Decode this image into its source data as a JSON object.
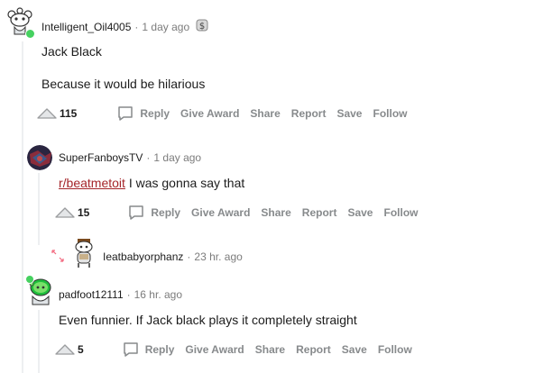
{
  "comments": [
    {
      "username": "Intelligent_Oil4005",
      "time": "1 day ago",
      "award_icon": "silver-award-icon",
      "lines": [
        "Jack Black",
        "Because it would be hilarious"
      ],
      "votes": "115",
      "actions": [
        "Reply",
        "Give Award",
        "Share",
        "Report",
        "Save",
        "Follow"
      ]
    },
    {
      "username": "SuperFanboysTV",
      "time": "1 day ago",
      "link_text": "r/beatmetoit",
      "text_after_link": " I was gonna say that",
      "votes": "15",
      "actions": [
        "Reply",
        "Give Award",
        "Share",
        "Report",
        "Save",
        "Follow"
      ]
    },
    {
      "username": "Ieatbabyorphanz",
      "time": "23 hr. ago",
      "collapsed": true
    },
    {
      "username": "padfoot12111",
      "time": "16 hr. ago",
      "lines": [
        "Even funnier. If Jack black plays it completely straight"
      ],
      "votes": "5",
      "actions": [
        "Reply",
        "Give Award",
        "Share",
        "Report",
        "Save",
        "Follow"
      ]
    }
  ],
  "colors": {
    "link": "#a5252a",
    "muted": "#878a8c",
    "thread_line": "#edeff1",
    "online_dot": "#46d160"
  }
}
